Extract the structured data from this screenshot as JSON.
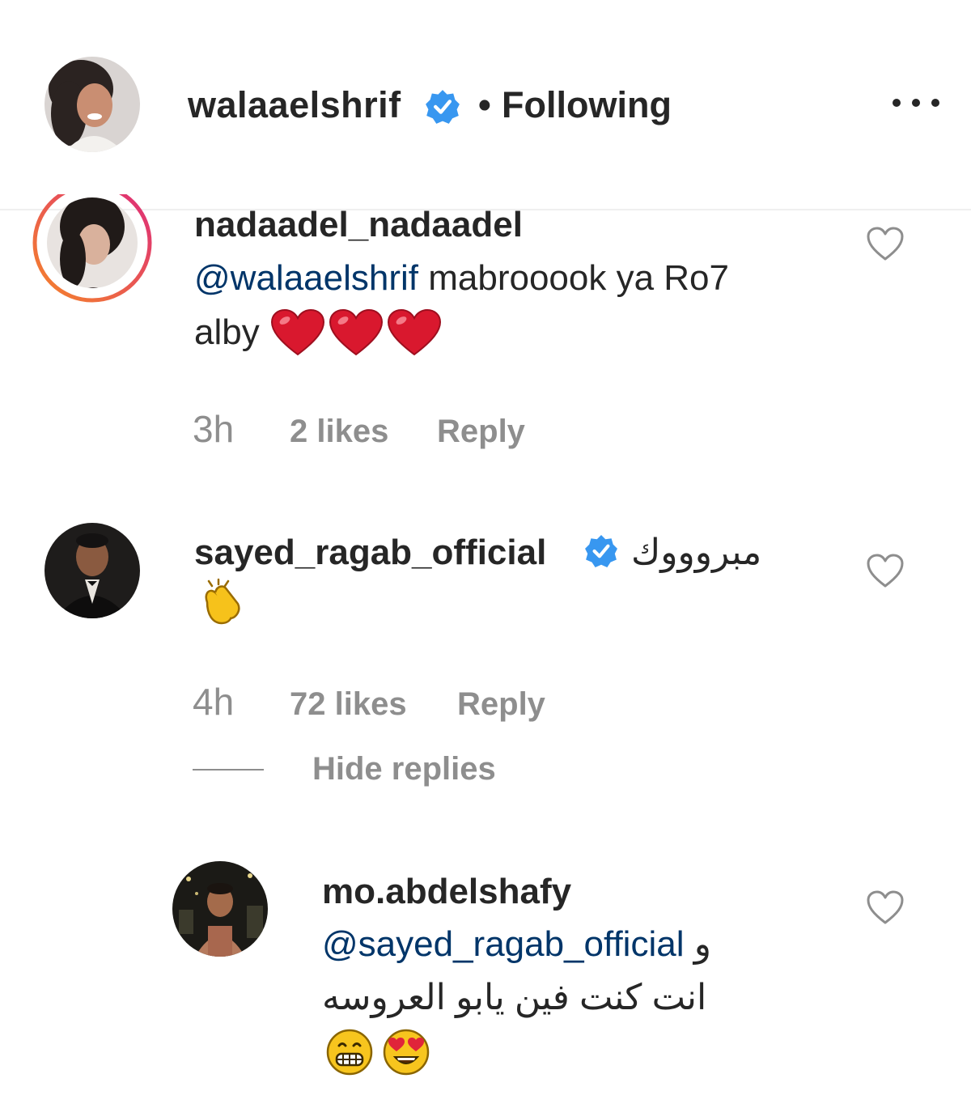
{
  "header": {
    "username": "walaaelshrif",
    "separator": "•",
    "follow_status": "Following"
  },
  "comments": [
    {
      "username": "nadaadel_nadaadel",
      "mention": "@walaaelshrif",
      "text_line1": " mabrooook ya Ro7",
      "text_line2": "alby",
      "emojis": [
        "red-heart",
        "red-heart",
        "red-heart"
      ],
      "time": "3h",
      "likes": "2 likes",
      "reply": "Reply"
    },
    {
      "username": "sayed_ragab_official",
      "text": "مبروووك",
      "emojis": [
        "clapping-hands"
      ],
      "time": "4h",
      "likes": "72 likes",
      "reply": "Reply",
      "hide_replies": "Hide replies",
      "replies": [
        {
          "username": "mo.abdelshafy",
          "mention": "@sayed_ragab_official",
          "text_prefix": "و",
          "text_line2": "انت كنت فين يابو العروسه",
          "emojis": [
            "grinning-face",
            "heart-eyes-face"
          ]
        }
      ]
    }
  ],
  "colors": {
    "text": "#262626",
    "muted": "#8e8e8e",
    "mention": "#003569",
    "verified": "#3897f0",
    "heart": "#e0245e",
    "story_ring_start": "#f58529",
    "story_ring_end": "#dd2a7b"
  }
}
